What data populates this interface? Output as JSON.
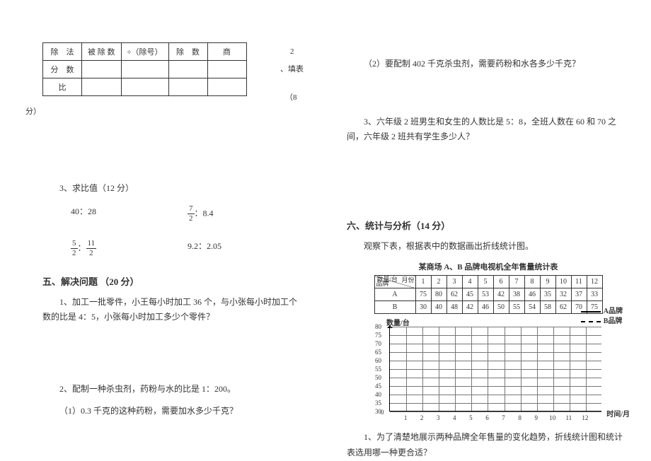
{
  "left": {
    "fill_table": {
      "headers": [
        "除　法",
        "被 除 数",
        "÷（除号）",
        "除　数",
        "商"
      ],
      "rows": [
        "分　数",
        "比"
      ]
    },
    "side_note": {
      "a": "2",
      "b": "、填表",
      "c": "（8",
      "d": "分）"
    },
    "q3": {
      "title": "3、求比值（12 分）",
      "items": [
        "40：28",
        "7/2：8.4",
        "5/2：11/2",
        "9.2：2.05"
      ]
    },
    "section5": {
      "title": "五、解决问题 （20 分）",
      "q1": "1、加工一批零件，小王每小时加工 36 个，与小张每小时加工个数的比是 4：5，小张每小时加工多少个零件？",
      "q2": "2、配制一种杀虫剂，药粉与水的比是 1：200。",
      "q2a": "（1）0.3 千克的这种药粉，需要加水多少千克？"
    }
  },
  "right": {
    "q2b": "（2）要配制 402 千克杀虫剂，需要药粉和水各多少千克？",
    "q3": "3、六年级 2 班男生和女生的人数比是 5：8，全班人数在 60 和 70 之间，六年级 2 班共有学生多少人？",
    "section6": {
      "title": "六、统计与分析（14 分）",
      "intro": "观察下表，根据表中的数据画出折线统计图。",
      "table_title": "某商场 A、B 品牌电视机全年售量统计表",
      "diag_top": "月份",
      "diag_bottom": "品牌",
      "diag_mid": "数量/台"
    },
    "legend": {
      "a": "A品牌",
      "b": "B品牌"
    },
    "axes": {
      "y": "数量/台",
      "x": "时间/月",
      "o": "0"
    },
    "q6_1": "1、为了清楚地展示两种品牌全年售量的变化趋势，折线统计图和统计表选用哪一种更合适？"
  },
  "chart_data": {
    "type": "table",
    "title": "某商场 A、B 品牌电视机全年售量统计表",
    "categories": [
      1,
      2,
      3,
      4,
      5,
      6,
      7,
      8,
      9,
      10,
      11,
      12
    ],
    "series": [
      {
        "name": "A",
        "values": [
          75,
          80,
          62,
          45,
          53,
          42,
          38,
          46,
          35,
          32,
          37,
          33
        ]
      },
      {
        "name": "B",
        "values": [
          30,
          40,
          48,
          42,
          46,
          50,
          55,
          54,
          58,
          62,
          70,
          75
        ]
      }
    ],
    "chart_grid": {
      "yticks": [
        30,
        35,
        40,
        45,
        50,
        55,
        60,
        65,
        70,
        75,
        80
      ],
      "xticks": [
        1,
        2,
        3,
        4,
        5,
        6,
        7,
        8,
        9,
        10,
        11,
        12
      ],
      "ylabel": "数量/台",
      "xlabel": "时间/月",
      "legend": [
        "A品牌",
        "B品牌"
      ]
    }
  }
}
